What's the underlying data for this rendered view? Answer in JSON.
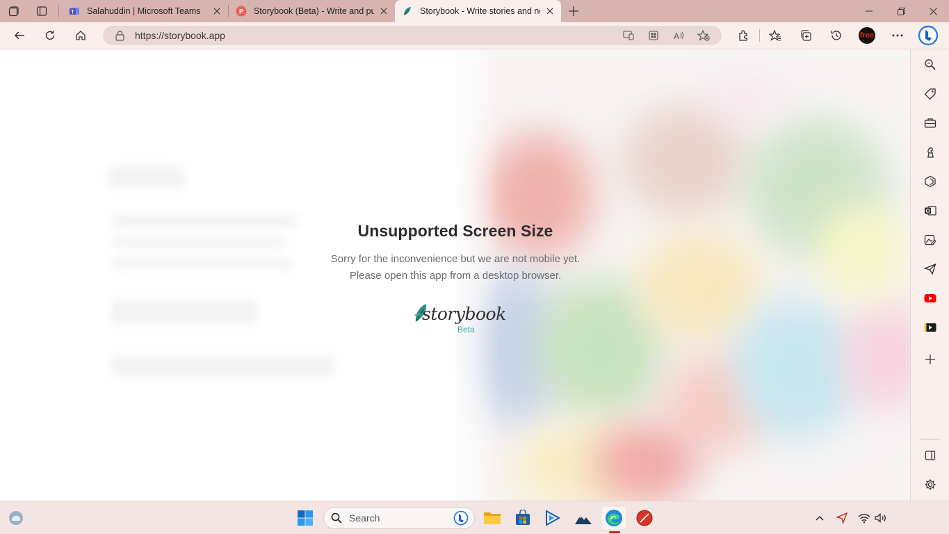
{
  "browser": {
    "tabs": [
      {
        "title": "Salahuddin | Microsoft Teams",
        "active": false
      },
      {
        "title": "Storybook (Beta) - Write and publish",
        "active": false
      },
      {
        "title": "Storybook - Write stories and novels",
        "active": true
      }
    ],
    "url": "https://storybook.app",
    "profile_badge": "free"
  },
  "page": {
    "heading": "Unsupported Screen Size",
    "line1": "Sorry for the inconvenience but we are not mobile yet.",
    "line2": "Please open this app from a desktop browser.",
    "logo_text": "storybook",
    "logo_badge": "Beta"
  },
  "taskbar": {
    "search_placeholder": "Search"
  },
  "colors": {
    "tabstrip": "#d8b4b1",
    "toolbar": "#fbefee",
    "accent_teal": "#3fa7a0",
    "heading": "#2c2c2c"
  }
}
